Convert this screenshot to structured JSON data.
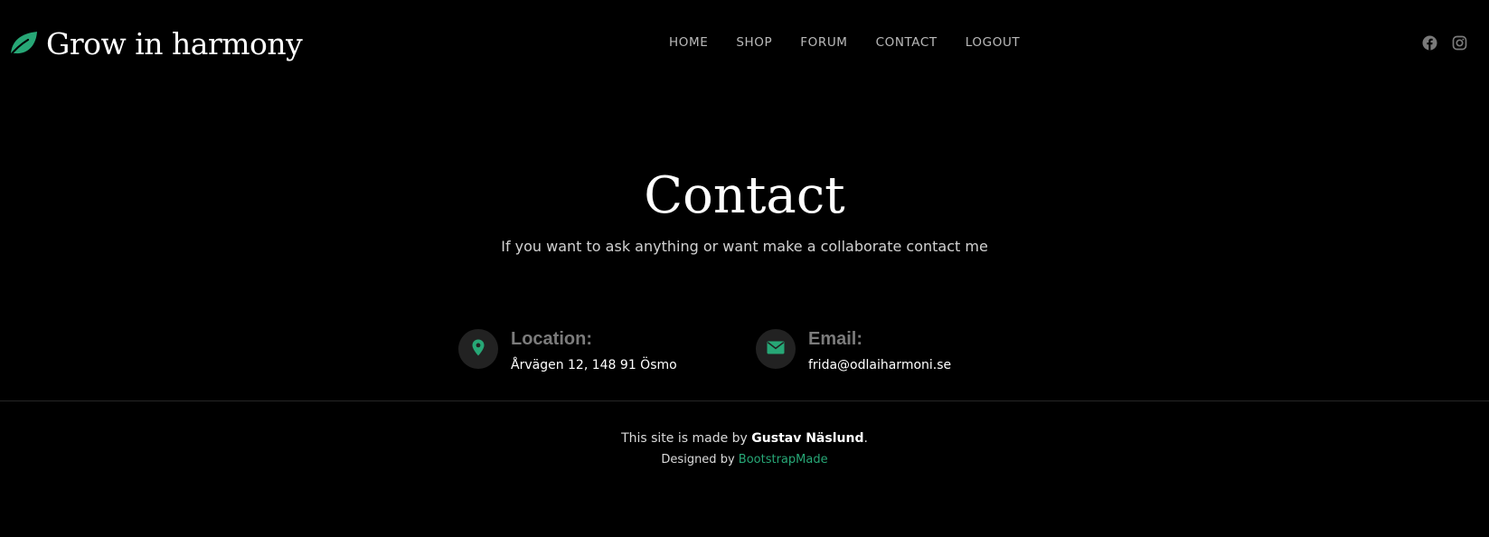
{
  "brand": {
    "name": "Grow in harmony",
    "icon": "leaf-icon",
    "accent_color": "#27a776"
  },
  "nav": {
    "items": [
      {
        "label": "HOME"
      },
      {
        "label": "SHOP"
      },
      {
        "label": "FORUM"
      },
      {
        "label": "CONTACT"
      },
      {
        "label": "LOGOUT"
      }
    ]
  },
  "social": {
    "icons": [
      "facebook-icon",
      "instagram-icon"
    ]
  },
  "contact": {
    "title": "Contact",
    "subtitle": "If you want to ask anything or want make a collaborate contact me",
    "location": {
      "icon": "map-pin-icon",
      "label": "Location:",
      "value": "Årvägen 12, 148 91 Ösmo"
    },
    "email": {
      "icon": "envelope-icon",
      "label": "Email:",
      "value": "frida@odlaiharmoni.se"
    }
  },
  "footer": {
    "credits_prefix": "This site is made by ",
    "credits_name": "Gustav Näslund",
    "credits_suffix": ".",
    "designed_prefix": "Designed by ",
    "designed_link": "BootstrapMade"
  }
}
